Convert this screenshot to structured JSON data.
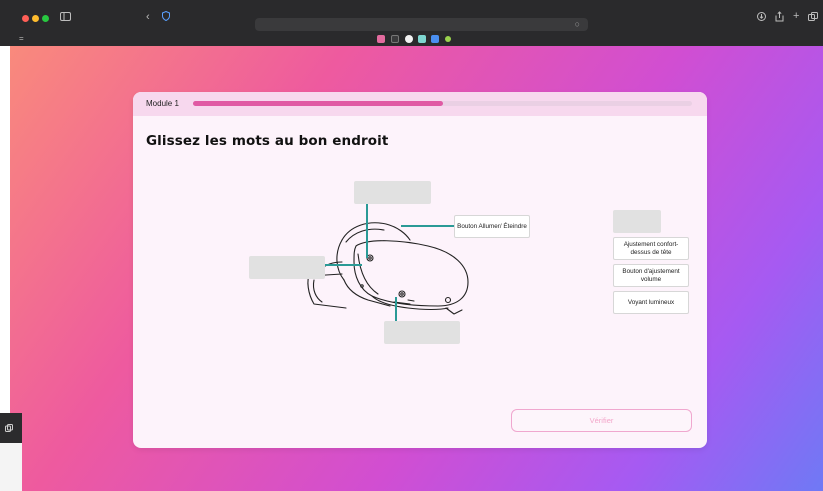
{
  "browser": {
    "icons": {
      "sidebar": "sidebar-icon",
      "back": "chevron-left-icon",
      "shield": "shield-icon",
      "download": "download-icon",
      "share": "share-icon",
      "new_tab": "plus-icon",
      "tabs_overview": "tabs-icon"
    }
  },
  "module": {
    "label": "Module 1",
    "progress": 0.5
  },
  "exercise": {
    "title": "Glissez les mots au bon endroit",
    "placed_label": "Bouton Allumer/ Éteindre",
    "word_bank": [
      "Ajustement confort-dessus de tête",
      "Bouton d'ajustement volume",
      "Voyant lumineux"
    ],
    "verify_label": "Vérifier"
  },
  "colors": {
    "accent": "#e05aa4",
    "connector": "#2a9a96",
    "button_text": "#f3a5c9"
  }
}
